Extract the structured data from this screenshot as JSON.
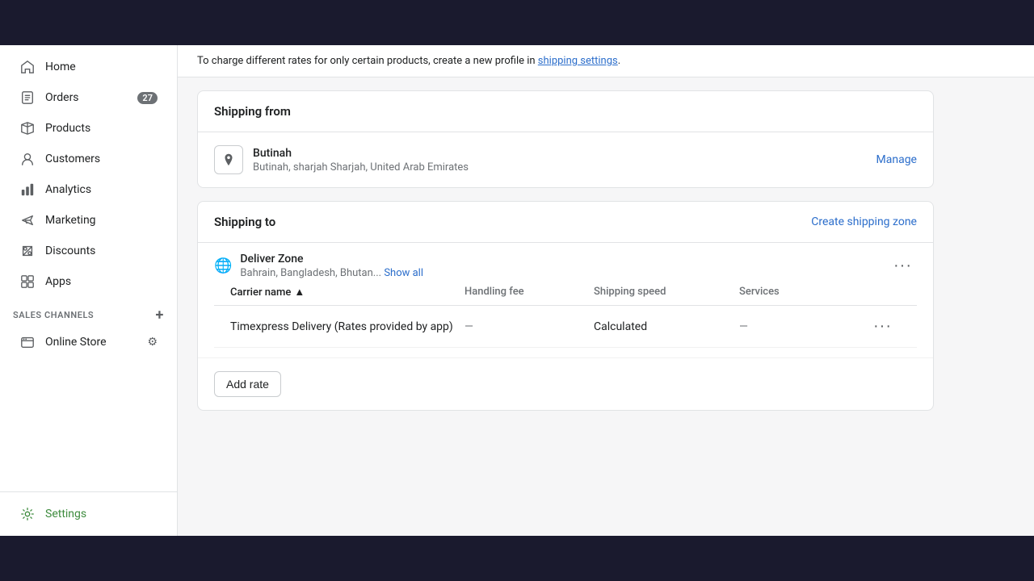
{
  "topbar": {
    "visible": true
  },
  "sidebar": {
    "items": [
      {
        "id": "home",
        "label": "Home",
        "icon": "home"
      },
      {
        "id": "orders",
        "label": "Orders",
        "icon": "orders",
        "badge": "27"
      },
      {
        "id": "products",
        "label": "Products",
        "icon": "products"
      },
      {
        "id": "customers",
        "label": "Customers",
        "icon": "customers"
      },
      {
        "id": "analytics",
        "label": "Analytics",
        "icon": "analytics"
      },
      {
        "id": "marketing",
        "label": "Marketing",
        "icon": "marketing"
      },
      {
        "id": "discounts",
        "label": "Discounts",
        "icon": "discounts"
      },
      {
        "id": "apps",
        "label": "Apps",
        "icon": "apps"
      }
    ],
    "sales_channels_title": "SALES CHANNELS",
    "sales_channels": [
      {
        "id": "online-store",
        "label": "Online Store"
      }
    ],
    "settings_label": "Settings"
  },
  "notice": {
    "text": "To charge different rates for only certain products, create a new profile in ",
    "link_text": "shipping settings",
    "suffix": "."
  },
  "shipping_from": {
    "section_title": "Shipping from",
    "location_name": "Butinah",
    "location_address": "Butinah, sharjah Sharjah, United Arab Emirates",
    "manage_label": "Manage"
  },
  "shipping_to": {
    "section_title": "Shipping to",
    "create_zone_label": "Create shipping zone",
    "zone_name": "Deliver Zone",
    "zone_countries": "Bahrain, Bangladesh, Bhutan...",
    "show_all_label": "Show all",
    "table": {
      "columns": [
        {
          "id": "carrier_name",
          "label": "Carrier name",
          "sortable": true
        },
        {
          "id": "handling_fee",
          "label": "Handling fee"
        },
        {
          "id": "shipping_speed",
          "label": "Shipping speed"
        },
        {
          "id": "services",
          "label": "Services"
        }
      ],
      "rows": [
        {
          "carrier_name": "Timexpress Delivery (Rates provided by app)",
          "handling_fee": "—",
          "shipping_speed": "Calculated",
          "services": "—"
        }
      ]
    },
    "add_rate_label": "Add rate"
  }
}
